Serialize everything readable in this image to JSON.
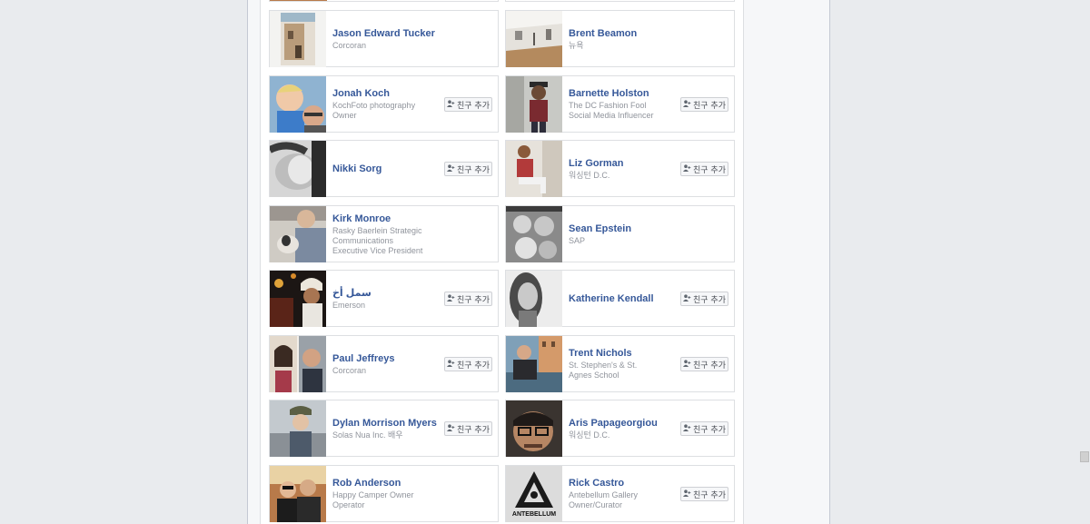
{
  "add_friend_label": "친구 추가",
  "add_friend_icon": "person-plus-icon",
  "friends": [
    {
      "name": "Jason Edward Tucker",
      "subtitle": "Corcoran",
      "show_add": false,
      "photo": "adobe-building"
    },
    {
      "name": "Brent Beamon",
      "subtitle": "뉴욕",
      "show_add": false,
      "photo": "gallery-room"
    },
    {
      "name": "Jonah Koch",
      "subtitle": "KochFoto photography Owner",
      "show_add": true,
      "photo": "child-selfie"
    },
    {
      "name": "Barnette Holston",
      "subtitle": "The DC Fashion Fool Social Media Influencer",
      "show_add": true,
      "photo": "man-hat"
    },
    {
      "name": "Nikki Sorg",
      "subtitle": "",
      "show_add": true,
      "photo": "bw-portrait"
    },
    {
      "name": "Liz Gorman",
      "subtitle": "워싱턴 D.C.",
      "show_add": true,
      "photo": "woman-sitting"
    },
    {
      "name": "Kirk Monroe",
      "subtitle": "Rasky Baerlein Strategic Communications Executive Vice President",
      "show_add": false,
      "photo": "man-dog"
    },
    {
      "name": "Sean Epstein",
      "subtitle": "SAP",
      "show_add": false,
      "photo": "bw-group"
    },
    {
      "name": "سمل أخ",
      "subtitle": "Emerson",
      "show_add": true,
      "photo": "night-turban"
    },
    {
      "name": "Katherine Kendall",
      "subtitle": "",
      "show_add": true,
      "photo": "bw-woman"
    },
    {
      "name": "Paul Jeffreys",
      "subtitle": "Corcoran",
      "show_add": true,
      "photo": "couple"
    },
    {
      "name": "Trent Nichols",
      "subtitle": "St. Stephen's & St. Agnes School",
      "show_add": true,
      "photo": "man-canal"
    },
    {
      "name": "Dylan Morrison Myers",
      "subtitle": "Solas Nua Inc. 배우",
      "show_add": true,
      "photo": "man-cap"
    },
    {
      "name": "Aris Papageorgiou",
      "subtitle": "워싱턴 D.C.",
      "show_add": true,
      "photo": "man-glasses"
    },
    {
      "name": "Rob Anderson",
      "subtitle": "Happy Camper Owner Operator",
      "show_add": false,
      "photo": "two-men"
    },
    {
      "name": "Rick Castro",
      "subtitle": "Antebellum Gallery Owner/Curator",
      "show_add": true,
      "photo": "antebellum-logo",
      "logo_text": "ANTEBELLUM"
    }
  ]
}
